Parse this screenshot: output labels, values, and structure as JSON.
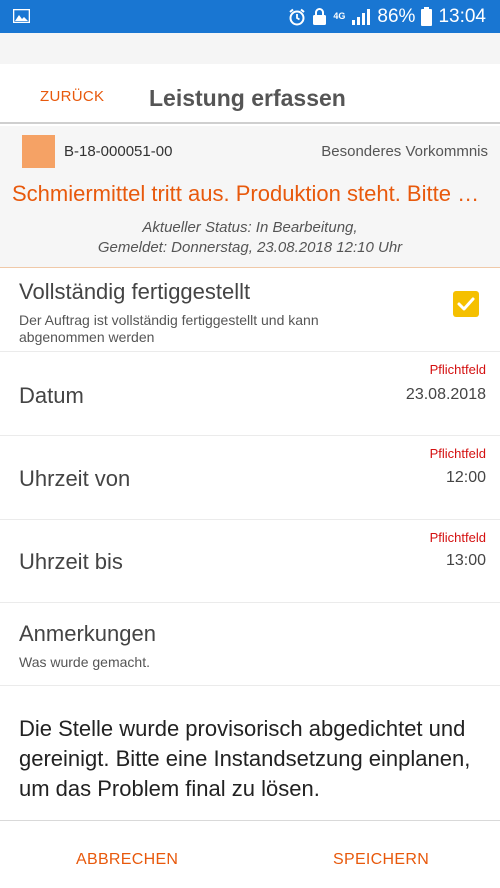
{
  "status_bar": {
    "battery_percent": "86%",
    "time": "13:04",
    "network_label": "4G",
    "icons": [
      "image-icon",
      "alarm-icon",
      "4g-icon",
      "signal-icon",
      "battery-icon"
    ]
  },
  "header": {
    "back_label": "ZURÜCK",
    "title": "Leistung erfassen"
  },
  "order": {
    "number": "B-18-000051-00",
    "category": "Besonderes Vorkommnis",
    "problem": "Schmiermittel tritt aus. Produktion steht. Bitte schnellstmöglich helfen",
    "status_line": "Aktueller Status: In Bearbeitung,",
    "reported_line": "Gemeldet: Donnerstag, 23.08.2018 12:10 Uhr",
    "swatch_color": "#f5a265"
  },
  "completed": {
    "title": "Vollständig fertiggestellt",
    "description": "Der Auftrag ist vollständig fertiggestellt und kann abgenommen werden",
    "checked": true
  },
  "fields": {
    "required_label": "Pflichtfeld",
    "date": {
      "label": "Datum",
      "value": "23.08.2018"
    },
    "time_from": {
      "label": "Uhrzeit von",
      "value": "12:00"
    },
    "time_to": {
      "label": "Uhrzeit bis",
      "value": "13:00"
    }
  },
  "remarks": {
    "title": "Anmerkungen",
    "hint": "Was wurde gemacht.",
    "text": "Die Stelle wurde provisorisch abgedichtet und gereinigt. Bitte eine Instandsetzung einplanen, um das Problem final zu lösen."
  },
  "footer": {
    "cancel_label": "ABBRECHEN",
    "save_label": "SPEICHERN"
  },
  "colors": {
    "accent": "#e8590c",
    "statusbar": "#1976d2",
    "required": "#d41010",
    "checkbox": "#f5c000"
  }
}
